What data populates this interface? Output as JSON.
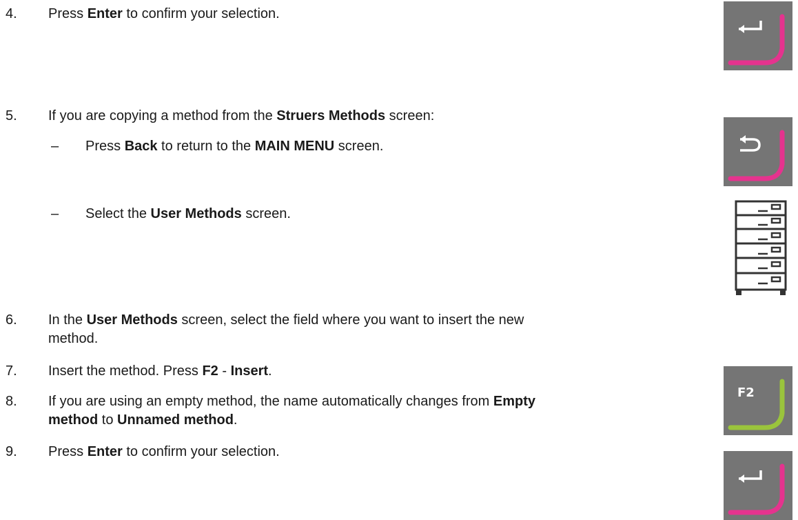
{
  "steps": [
    {
      "num": "4.",
      "parts": [
        "Press ",
        "Enter",
        " to confirm your selection."
      ]
    },
    {
      "num": "5.",
      "parts": [
        "If you are copying a method from the ",
        "Struers Methods",
        " screen:"
      ]
    },
    {
      "num": "6.",
      "line1": [
        "In the ",
        "User Methods",
        " screen, select the field where you want to insert the new"
      ],
      "line2": "method."
    },
    {
      "num": "7.",
      "parts": [
        "Insert the method. Press ",
        "F2",
        " - ",
        "Insert",
        "."
      ]
    },
    {
      "num": "8.",
      "line1": [
        "If you are using an empty method, the name automatically changes from ",
        "Empty"
      ],
      "line2": [
        "method",
        " to ",
        "Unnamed method",
        "."
      ]
    },
    {
      "num": "9.",
      "parts": [
        "Press ",
        "Enter",
        " to confirm your selection."
      ]
    }
  ],
  "substeps": [
    {
      "dash": "–",
      "parts": [
        "Press ",
        "Back",
        " to return to the ",
        "MAIN MENU",
        " screen."
      ]
    },
    {
      "dash": "–",
      "parts": [
        "Select the ",
        "User Methods",
        " screen."
      ]
    }
  ],
  "keys": {
    "enter_icon": "enter-key-icon",
    "back_icon": "back-key-icon",
    "methods_icon": "user-methods-icon",
    "f2_label": "F2",
    "magenta": "#e5338e",
    "green": "#9ac43c",
    "gray": "#757575"
  }
}
